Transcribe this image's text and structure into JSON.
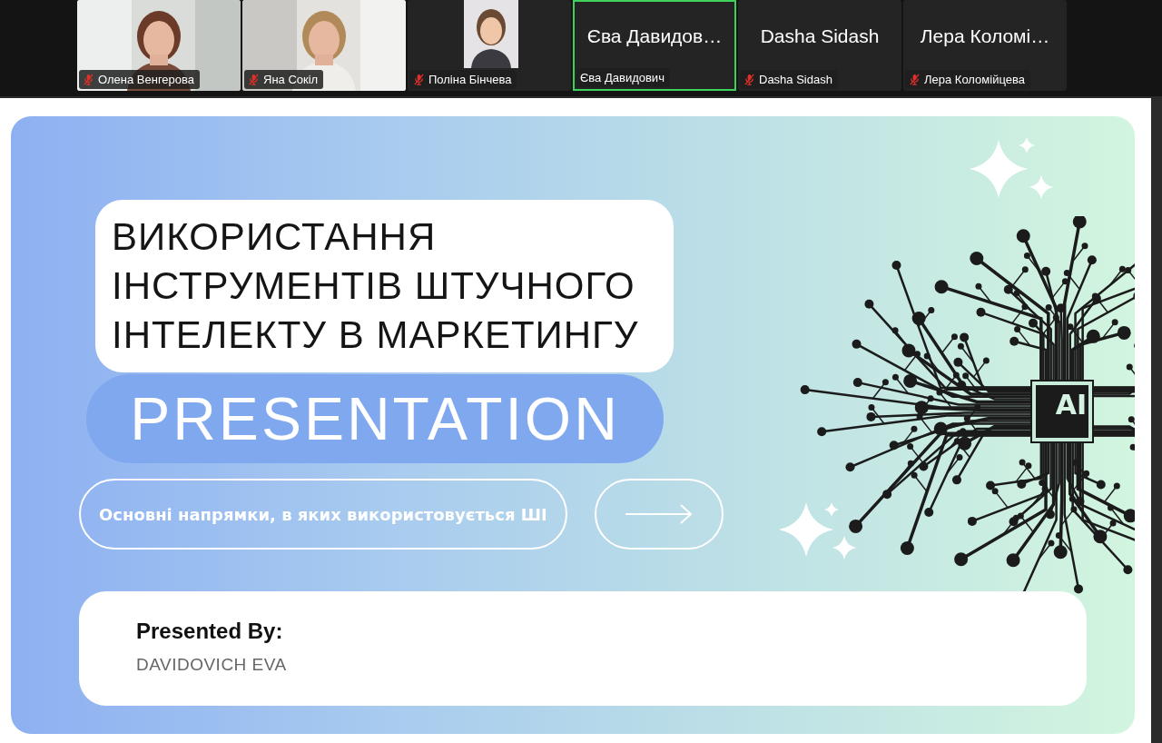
{
  "participants": [
    {
      "kind": "video",
      "name": "Олена Венгерова",
      "muted": true,
      "active_speaker": false
    },
    {
      "kind": "video",
      "name": "Яна Сокіл",
      "muted": true,
      "active_speaker": false
    },
    {
      "kind": "avatar",
      "name": "Поліна Бінчева",
      "muted": true,
      "active_speaker": false
    },
    {
      "kind": "name",
      "display_name": "Єва Давидов…",
      "name": "Єва Давидович",
      "muted": false,
      "active_speaker": true
    },
    {
      "kind": "name",
      "display_name": "Dasha Sidash",
      "name": "Dasha Sidash",
      "muted": true,
      "active_speaker": false
    },
    {
      "kind": "name",
      "display_name": "Лера Коломі…",
      "name": "Лера Коломійцева",
      "muted": true,
      "active_speaker": false
    }
  ],
  "slide": {
    "title_lines": [
      "ВИКОРИСТАННЯ",
      "ІНСТРУМЕНТІВ ШТУЧНОГО",
      "ІНТЕЛЕКТУ В МАРКЕТИНГУ"
    ],
    "subtitle": "PRESENTATION",
    "topic_button": "Основні напрямки, в яких використовується ШІ",
    "chip_label": "AI",
    "presented_by_label": "Presented By:",
    "presenter": "DAVIDOVICH EVA"
  }
}
